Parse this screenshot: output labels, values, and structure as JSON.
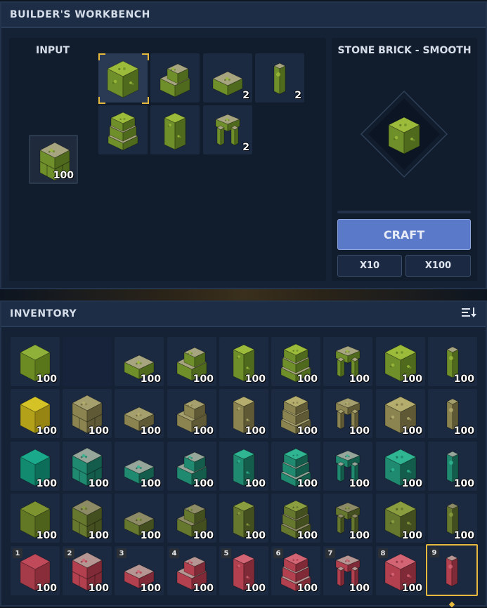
{
  "workbench": {
    "title": "BUILDER'S WORKBENCH",
    "input_label": "INPUT",
    "input_slot": {
      "icon": "mossy-stone-brick-block-icon",
      "count": "100"
    },
    "variants": [
      {
        "icon": "mossy-stone-block-icon",
        "count": "",
        "selected": true
      },
      {
        "icon": "mossy-brick-stairs-icon",
        "count": ""
      },
      {
        "icon": "mossy-brick-slab-icon",
        "count": "2"
      },
      {
        "icon": "mossy-brick-pillar-icon",
        "count": "2"
      },
      {
        "icon": "mossy-brick-bricks-icon",
        "count": ""
      },
      {
        "icon": "mossy-stone-panel-icon",
        "count": ""
      },
      {
        "icon": "mossy-brick-arch-icon",
        "count": "2"
      }
    ]
  },
  "result": {
    "title": "STONE BRICK - SMOOTH",
    "icon": "mossy-stone-block-icon",
    "craft_label": "CRAFT",
    "x10_label": "X10",
    "x100_label": "X100"
  },
  "inventory": {
    "title": "INVENTORY",
    "sort_icon": "sort-icon",
    "rows": [
      [
        {
          "icon": "moss-cube-icon",
          "count": "100"
        },
        {
          "icon": "",
          "count": ""
        },
        {
          "icon": "mossy-brick-slab-icon",
          "count": "100"
        },
        {
          "icon": "mossy-brick-stairs-icon",
          "count": "100"
        },
        {
          "icon": "mossy-stone-panel-icon",
          "count": "100"
        },
        {
          "icon": "mossy-brick-bricks-icon",
          "count": "100"
        },
        {
          "icon": "mossy-brick-arch-icon",
          "count": "100"
        },
        {
          "icon": "mossy-stone-block-icon",
          "count": "100"
        },
        {
          "icon": "mossy-brick-pillar-icon",
          "count": "100"
        }
      ],
      [
        {
          "icon": "yellow-cube-icon",
          "count": "100"
        },
        {
          "icon": "tan-brick-block-icon",
          "count": "100"
        },
        {
          "icon": "tan-brick-slab-icon",
          "count": "100"
        },
        {
          "icon": "tan-brick-stairs-icon",
          "count": "100"
        },
        {
          "icon": "tan-stone-panel-icon",
          "count": "100"
        },
        {
          "icon": "tan-brick-bricks-icon",
          "count": "100"
        },
        {
          "icon": "tan-brick-arch-icon",
          "count": "100"
        },
        {
          "icon": "tan-stone-block-icon",
          "count": "100"
        },
        {
          "icon": "tan-brick-pillar-icon",
          "count": "100"
        }
      ],
      [
        {
          "icon": "teal-cube-icon",
          "count": "100"
        },
        {
          "icon": "teal-brick-block-icon",
          "count": "100"
        },
        {
          "icon": "teal-brick-slab-icon",
          "count": "100"
        },
        {
          "icon": "teal-brick-stairs-icon",
          "count": "100"
        },
        {
          "icon": "teal-stone-panel-icon",
          "count": "100"
        },
        {
          "icon": "teal-brick-bricks-icon",
          "count": "100"
        },
        {
          "icon": "teal-brick-arch-icon",
          "count": "100"
        },
        {
          "icon": "teal-stone-block-icon",
          "count": "100"
        },
        {
          "icon": "teal-brick-pillar-icon",
          "count": "100"
        }
      ],
      [
        {
          "icon": "olive-cube-icon",
          "count": "100"
        },
        {
          "icon": "olive-brick-block-icon",
          "count": "100"
        },
        {
          "icon": "olive-brick-slab-icon",
          "count": "100"
        },
        {
          "icon": "olive-brick-stairs-icon",
          "count": "100"
        },
        {
          "icon": "olive-stone-panel-icon",
          "count": "100"
        },
        {
          "icon": "olive-brick-bricks-icon",
          "count": "100"
        },
        {
          "icon": "olive-brick-arch-icon",
          "count": "100"
        },
        {
          "icon": "olive-stone-block-icon",
          "count": "100"
        },
        {
          "icon": "olive-brick-pillar-icon",
          "count": "100"
        }
      ]
    ],
    "hotbar": [
      {
        "num": "1",
        "icon": "red-cube-icon",
        "count": "100"
      },
      {
        "num": "2",
        "icon": "red-brick-block-icon",
        "count": "100"
      },
      {
        "num": "3",
        "icon": "red-brick-slab-icon",
        "count": "100"
      },
      {
        "num": "4",
        "icon": "red-brick-stairs-icon",
        "count": "100"
      },
      {
        "num": "5",
        "icon": "red-stone-panel-icon",
        "count": "100"
      },
      {
        "num": "6",
        "icon": "red-brick-bricks-icon",
        "count": "100"
      },
      {
        "num": "7",
        "icon": "red-brick-arch-icon",
        "count": "100"
      },
      {
        "num": "8",
        "icon": "red-stone-block-icon",
        "count": "100"
      },
      {
        "num": "9",
        "icon": "red-brick-pillar-icon",
        "count": "",
        "selected": true
      }
    ]
  },
  "colors": {
    "moss": "#7a9a2e",
    "yellow": "#c9b51e",
    "teal": "#15917a",
    "olive": "#6d8424",
    "red": "#b63f50",
    "tan": "#8f8a4a",
    "accent": "#e7b93f",
    "craft": "#5b79c9"
  }
}
